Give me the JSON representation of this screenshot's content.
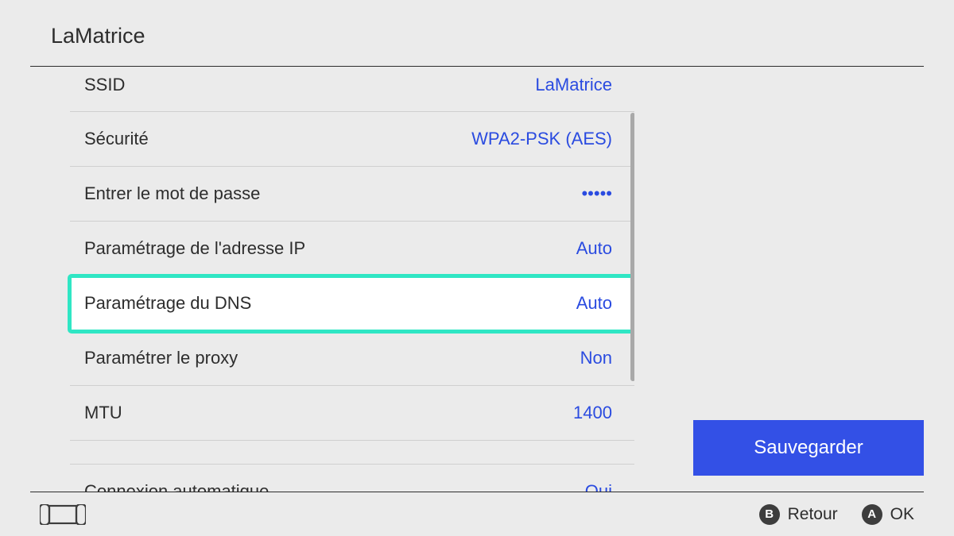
{
  "header": {
    "title": "LaMatrice"
  },
  "rows": [
    {
      "label": "SSID",
      "value": "LaMatrice",
      "selected": false
    },
    {
      "label": "Sécurité",
      "value": "WPA2-PSK (AES)",
      "selected": false
    },
    {
      "label": "Entrer le mot de passe",
      "value": "•••••",
      "selected": false
    },
    {
      "label": "Paramétrage de l'adresse IP",
      "value": "Auto",
      "selected": false
    },
    {
      "label": "Paramétrage du DNS",
      "value": "Auto",
      "selected": true
    },
    {
      "label": "Paramétrer le proxy",
      "value": "Non",
      "selected": false
    },
    {
      "label": "MTU",
      "value": "1400",
      "selected": false
    }
  ],
  "extra_row": {
    "label": "Connexion automatique",
    "value": "Oui"
  },
  "side": {
    "save_label": "Sauvegarder"
  },
  "footer": {
    "b_label": "Retour",
    "a_label": "OK",
    "b_glyph": "B",
    "a_glyph": "A"
  }
}
